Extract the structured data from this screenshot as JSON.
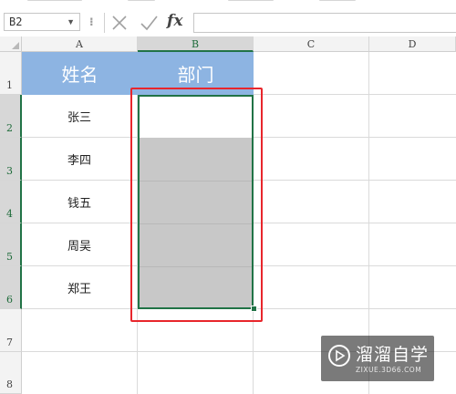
{
  "formula_bar": {
    "name_box": "B2",
    "formula": ""
  },
  "columns": [
    "A",
    "B",
    "C",
    "D"
  ],
  "rows": [
    "1",
    "2",
    "3",
    "4",
    "5",
    "6",
    "7",
    "8"
  ],
  "table": {
    "header_name": "姓名",
    "header_dept": "部门",
    "names": [
      "张三",
      "李四",
      "钱五",
      "周吴",
      "郑王"
    ]
  },
  "watermark": {
    "title": "溜溜自学",
    "url": "ZIXUE.3D66.COM"
  },
  "colors": {
    "header_fill": "#8db4e2",
    "selection_shade": "#c8c8c8",
    "selection_border": "#217346",
    "annotation_red": "#e8262c"
  },
  "icons": [
    "cancel-icon",
    "enter-checkmark-icon",
    "function-fx-icon",
    "dropdown-arrow-icon",
    "play-logo-icon"
  ]
}
